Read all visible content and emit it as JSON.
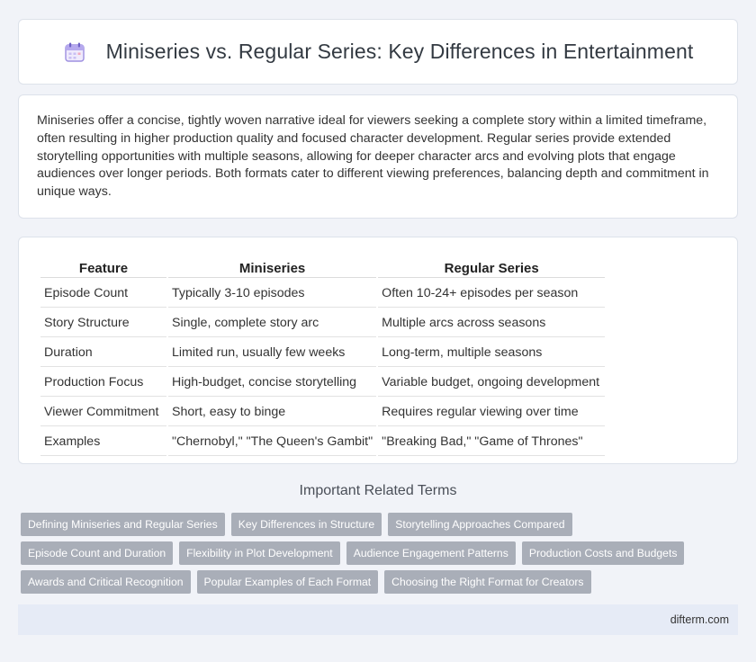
{
  "header": {
    "title": "Miniseries vs. Regular Series: Key Differences in Entertainment",
    "icon": "calendar-icon"
  },
  "intro": {
    "text": "Miniseries offer a concise, tightly woven narrative ideal for viewers seeking a complete story within a limited timeframe, often resulting in higher production quality and focused character development. Regular series provide extended storytelling opportunities with multiple seasons, allowing for deeper character arcs and evolving plots that engage audiences over longer periods. Both formats cater to different viewing preferences, balancing depth and commitment in unique ways."
  },
  "table": {
    "headers": [
      "Feature",
      "Miniseries",
      "Regular Series"
    ],
    "rows": [
      [
        "Episode Count",
        "Typically 3-10 episodes",
        "Often 10-24+ episodes per season"
      ],
      [
        "Story Structure",
        "Single, complete story arc",
        "Multiple arcs across seasons"
      ],
      [
        "Duration",
        "Limited run, usually few weeks",
        "Long-term, multiple seasons"
      ],
      [
        "Production Focus",
        "High-budget, concise storytelling",
        "Variable budget, ongoing development"
      ],
      [
        "Viewer Commitment",
        "Short, easy to binge",
        "Requires regular viewing over time"
      ],
      [
        "Examples",
        "\"Chernobyl,\" \"The Queen's Gambit\"",
        "\"Breaking Bad,\" \"Game of Thrones\""
      ]
    ]
  },
  "related": {
    "title": "Important Related Terms",
    "tags": [
      "Defining Miniseries and Regular Series",
      "Key Differences in Structure",
      "Storytelling Approaches Compared",
      "Episode Count and Duration",
      "Flexibility in Plot Development",
      "Audience Engagement Patterns",
      "Production Costs and Budgets",
      "Awards and Critical Recognition",
      "Popular Examples of Each Format",
      "Choosing the Right Format for Creators"
    ]
  },
  "footer": {
    "brand": "difterm.com"
  },
  "colors": {
    "background": "#f1f3f8",
    "tag_bg": "#a9aeb8",
    "footer_bg": "#e6ebf6",
    "icon_accent": "#8b7fd6"
  }
}
